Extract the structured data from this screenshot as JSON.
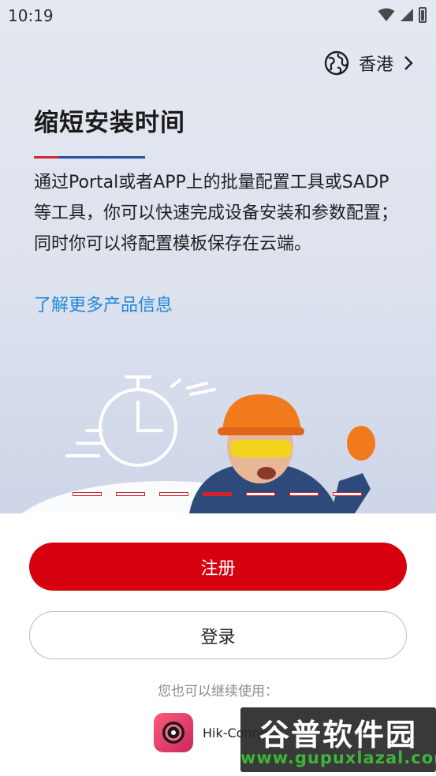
{
  "status_bar": {
    "time": "10:19"
  },
  "region": {
    "label": "香港"
  },
  "hero": {
    "title": "缩短安装时间",
    "description": "通过Portal或者APP上的批量配置工具或SADP等工具，你可以快速完成设备安装和参数配置；同时你可以将配置模板保存在云端。",
    "learn_more": "了解更多产品信息"
  },
  "carousel": {
    "page_count": 7,
    "active_index": 3
  },
  "buttons": {
    "register": "注册",
    "login": "登录"
  },
  "also_use": {
    "label": "您也可以继续使用："
  },
  "app": {
    "name": "Hik-Connect"
  },
  "watermark": {
    "title": "谷普软件园",
    "url": "www.gupuxlazal.com"
  },
  "colors": {
    "brand_red": "#d7000f",
    "link_blue": "#1e88d8",
    "accent_blue": "#2b4aa0"
  }
}
